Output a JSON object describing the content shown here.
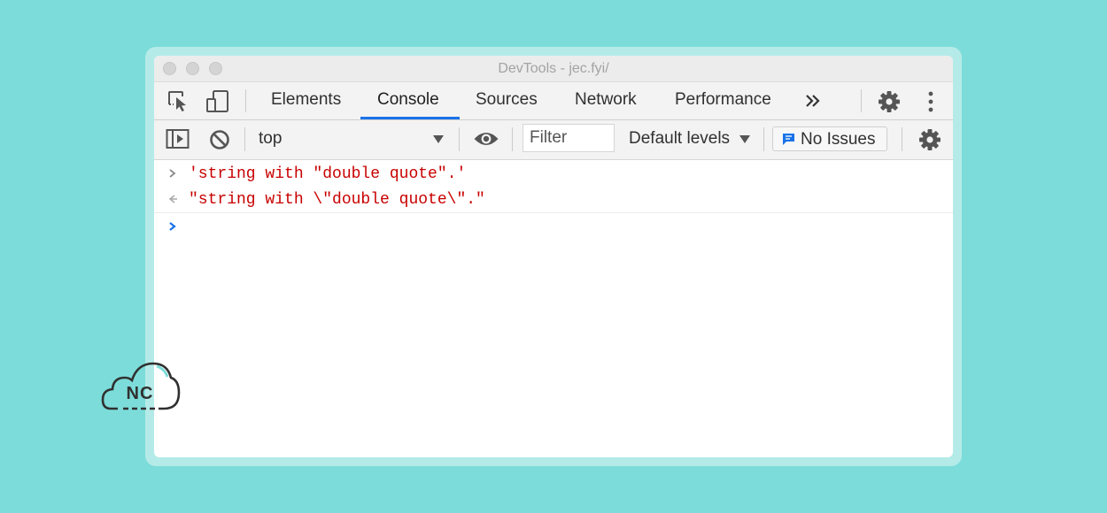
{
  "window": {
    "title": "DevTools - jec.fyi/"
  },
  "tabs": [
    {
      "label": "Elements",
      "active": false
    },
    {
      "label": "Console",
      "active": true
    },
    {
      "label": "Sources",
      "active": false
    },
    {
      "label": "Network",
      "active": false
    },
    {
      "label": "Performance",
      "active": false
    }
  ],
  "toolbar": {
    "context_value": "top",
    "filter_placeholder": "Filter",
    "levels_label": "Default levels",
    "issues_label": "No Issues"
  },
  "console": {
    "lines": [
      {
        "type": "input",
        "text": "'string with \"double quote\".'"
      },
      {
        "type": "result",
        "text": "\"string with \\\"double quote\\\".\""
      }
    ]
  },
  "watermark": {
    "text": "NC"
  },
  "colors": {
    "background": "#7cdcd9",
    "accent": "#1a73e8",
    "string": "#c80000",
    "issues_icon": "#1a73e8"
  },
  "icons": {
    "tabbar": [
      "inspect-element-icon",
      "device-toggle-icon",
      "more-tabs-icon",
      "settings-gear-icon",
      "kebab-menu-icon"
    ],
    "toolbar": [
      "sidebar-toggle-icon",
      "clear-console-icon",
      "dropdown-arrow-icon",
      "live-expression-eye-icon",
      "settings-gear-icon"
    ]
  }
}
